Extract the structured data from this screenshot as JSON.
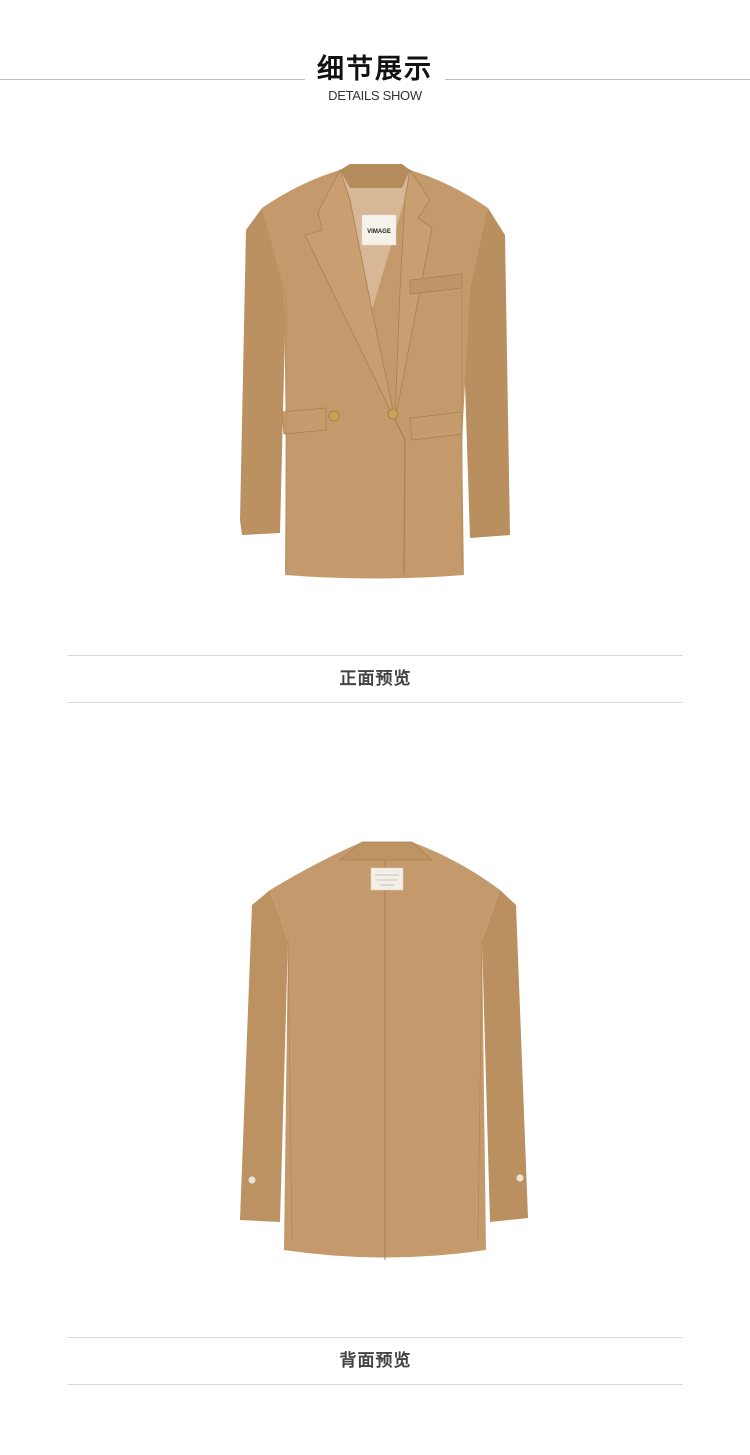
{
  "header": {
    "title": "细节展示",
    "subtitle": "DETAILS SHOW"
  },
  "front": {
    "caption": "正面预览",
    "label_text": "VIMAGE"
  },
  "back": {
    "caption": "背面预览"
  },
  "colors": {
    "fabric": "#c49a6c",
    "fabric_shadow": "#a9804f",
    "fabric_light": "#d3ab7e",
    "button_gold": "#c9a25a",
    "rule": "#d9d9d9"
  }
}
